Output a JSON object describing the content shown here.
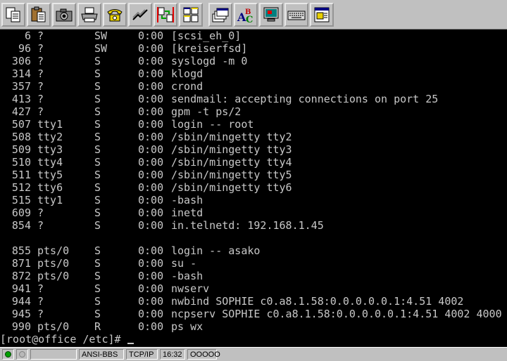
{
  "toolbar": {
    "buttons": [
      {
        "icon": "copy-icon"
      },
      {
        "icon": "paste-icon"
      },
      {
        "icon": "camera-icon"
      },
      {
        "icon": "print-icon"
      },
      {
        "icon": "phone-icon"
      },
      {
        "icon": "hangup-icon"
      },
      {
        "icon": "transfer-icon"
      },
      {
        "icon": "tile-windows-icon"
      },
      {
        "icon": "stack-windows-icon"
      },
      {
        "icon": "spellcheck-icon"
      },
      {
        "icon": "monitor-icon"
      },
      {
        "icon": "keyboard-icon"
      },
      {
        "icon": "notepad-icon"
      }
    ]
  },
  "terminal": {
    "processes": [
      {
        "pid": "6",
        "tty": "?",
        "stat": "SW",
        "time": "0:00",
        "command": "[scsi_eh_0]"
      },
      {
        "pid": "96",
        "tty": "?",
        "stat": "SW",
        "time": "0:00",
        "command": "[kreiserfsd]"
      },
      {
        "pid": "306",
        "tty": "?",
        "stat": "S",
        "time": "0:00",
        "command": "syslogd -m 0"
      },
      {
        "pid": "314",
        "tty": "?",
        "stat": "S",
        "time": "0:00",
        "command": "klogd"
      },
      {
        "pid": "357",
        "tty": "?",
        "stat": "S",
        "time": "0:00",
        "command": "crond"
      },
      {
        "pid": "413",
        "tty": "?",
        "stat": "S",
        "time": "0:00",
        "command": "sendmail: accepting connections on port 25"
      },
      {
        "pid": "427",
        "tty": "?",
        "stat": "S",
        "time": "0:00",
        "command": "gpm -t ps/2"
      },
      {
        "pid": "507",
        "tty": "tty1",
        "stat": "S",
        "time": "0:00",
        "command": "login -- root"
      },
      {
        "pid": "508",
        "tty": "tty2",
        "stat": "S",
        "time": "0:00",
        "command": "/sbin/mingetty tty2"
      },
      {
        "pid": "509",
        "tty": "tty3",
        "stat": "S",
        "time": "0:00",
        "command": "/sbin/mingetty tty3"
      },
      {
        "pid": "510",
        "tty": "tty4",
        "stat": "S",
        "time": "0:00",
        "command": "/sbin/mingetty tty4"
      },
      {
        "pid": "511",
        "tty": "tty5",
        "stat": "S",
        "time": "0:00",
        "command": "/sbin/mingetty tty5"
      },
      {
        "pid": "512",
        "tty": "tty6",
        "stat": "S",
        "time": "0:00",
        "command": "/sbin/mingetty tty6"
      },
      {
        "pid": "515",
        "tty": "tty1",
        "stat": "S",
        "time": "0:00",
        "command": "-bash"
      },
      {
        "pid": "609",
        "tty": "?",
        "stat": "S",
        "time": "0:00",
        "command": "inetd"
      },
      {
        "pid": "854",
        "tty": "?",
        "stat": "S",
        "time": "0:00",
        "command": "in.telnetd: 192.168.1.45"
      },
      {
        "pid": "",
        "tty": "",
        "stat": "",
        "time": "",
        "command": ""
      },
      {
        "pid": "855",
        "tty": "pts/0",
        "stat": "S",
        "time": "0:00",
        "command": "login -- asako"
      },
      {
        "pid": "871",
        "tty": "pts/0",
        "stat": "S",
        "time": "0:00",
        "command": "su -"
      },
      {
        "pid": "872",
        "tty": "pts/0",
        "stat": "S",
        "time": "0:00",
        "command": "-bash"
      },
      {
        "pid": "941",
        "tty": "?",
        "stat": "S",
        "time": "0:00",
        "command": "nwserv"
      },
      {
        "pid": "944",
        "tty": "?",
        "stat": "S",
        "time": "0:00",
        "command": "nwbind SOPHIE c0.a8.1.58:0.0.0.0.0.1:4.51 4002"
      },
      {
        "pid": "945",
        "tty": "?",
        "stat": "S",
        "time": "0:00",
        "command": "ncpserv SOPHIE c0.a8.1.58:0.0.0.0.0.1:4.51 4002 4000"
      },
      {
        "pid": "990",
        "tty": "pts/0",
        "stat": "R",
        "time": "0:00",
        "command": "ps wx"
      }
    ],
    "prompt": "[root@office /etc]#"
  },
  "statusbar": {
    "emulation": "ANSI-BBS",
    "protocol": "TCP/IP",
    "clock": "16:32",
    "indicators": "OOOOO"
  },
  "colors": {
    "terminal_bg": "#000000",
    "terminal_fg": "#c8c8c8",
    "chrome": "#c0c0c0"
  }
}
